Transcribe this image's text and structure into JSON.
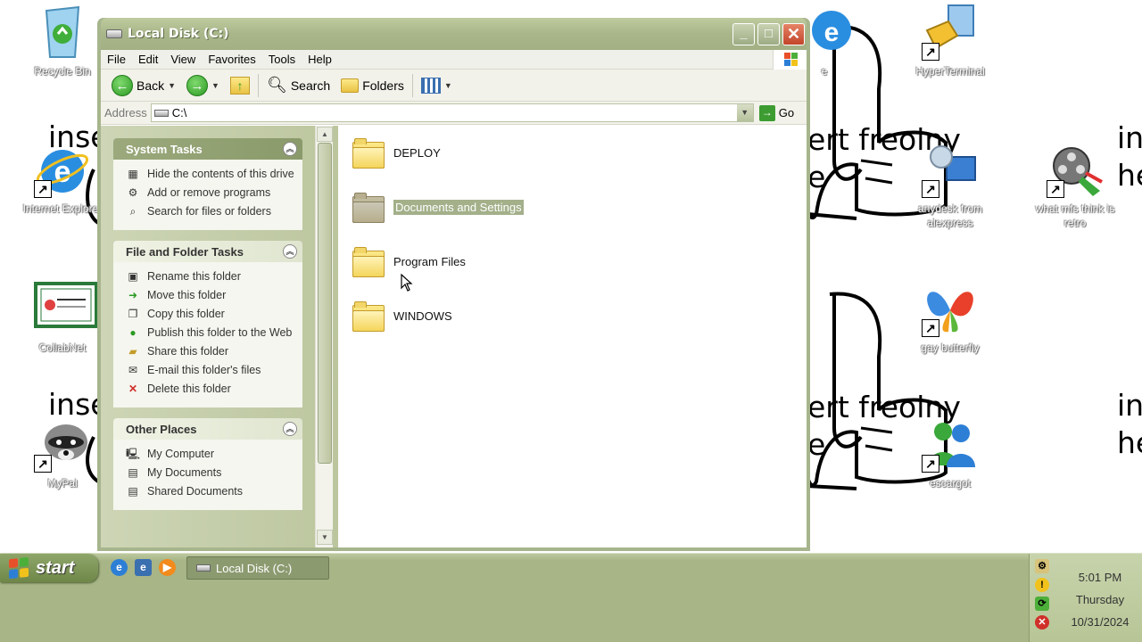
{
  "desktop": {
    "icons": {
      "recycle_bin": "Recycle Bin",
      "internet_explorer": "Internet Explorer",
      "collabnet": "CollabNet",
      "mypal": "MyPal",
      "e": "e",
      "hyperterminal": "HyperTerminal",
      "anydesk": "anydesk from alexpress",
      "what_mfs": "what mfs think is retro",
      "gay_butterfly": "gay butterfly",
      "escargot": "escargot"
    },
    "wallpaper_text": {
      "inse_1": "inse",
      "inse_2": "inse",
      "ert_freolny_1": "ert freolny",
      "e_1": "e",
      "ert_freolny_2": "ert freolny",
      "e_2": "e",
      "in_1": "in",
      "he_1": "he",
      "in_2": "in",
      "he_2": "he"
    }
  },
  "window": {
    "title": "Local Disk (C:)",
    "menu": [
      "File",
      "Edit",
      "View",
      "Favorites",
      "Tools",
      "Help"
    ],
    "toolbar": {
      "back": "Back",
      "search": "Search",
      "folders": "Folders"
    },
    "address": {
      "label": "Address",
      "value": "C:\\",
      "go": "Go"
    },
    "panels": {
      "system_tasks": {
        "title": "System Tasks",
        "items": [
          {
            "label": "Hide the contents of this drive",
            "icon": "hide-icon"
          },
          {
            "label": "Add or remove programs",
            "icon": "programs-icon"
          },
          {
            "label": "Search for files or folders",
            "icon": "search-icon"
          }
        ]
      },
      "file_folder_tasks": {
        "title": "File and Folder Tasks",
        "items": [
          {
            "label": "Rename this folder",
            "icon": "rename-icon"
          },
          {
            "label": "Move this folder",
            "icon": "move-icon"
          },
          {
            "label": "Copy this folder",
            "icon": "copy-icon"
          },
          {
            "label": "Publish this folder to the Web",
            "icon": "globe-icon"
          },
          {
            "label": "Share this folder",
            "icon": "share-icon"
          },
          {
            "label": "E-mail this folder's files",
            "icon": "email-icon"
          },
          {
            "label": "Delete this folder",
            "icon": "delete-icon"
          }
        ]
      },
      "other_places": {
        "title": "Other Places",
        "items": [
          {
            "label": "My Computer",
            "icon": "computer-icon"
          },
          {
            "label": "My Documents",
            "icon": "documents-icon"
          },
          {
            "label": "Shared Documents",
            "icon": "shared-documents-icon"
          }
        ]
      }
    },
    "folders": [
      {
        "name": "DEPLOY",
        "selected": false
      },
      {
        "name": "Documents and Settings",
        "selected": true
      },
      {
        "name": "Program Files",
        "selected": false
      },
      {
        "name": "WINDOWS",
        "selected": false
      }
    ]
  },
  "taskbar": {
    "start_label": "start",
    "task_button": "Local Disk (C:)",
    "clock": {
      "time": "5:01 PM",
      "day": "Thursday",
      "date": "10/31/2024"
    }
  },
  "colors": {
    "accent": "#a7b58d",
    "selection": "#a3b08a",
    "taskbar": "#a7b587"
  }
}
